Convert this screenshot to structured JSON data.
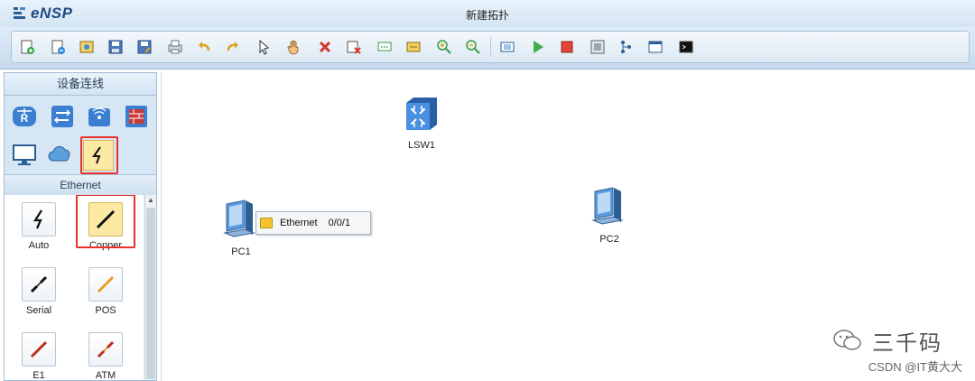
{
  "app": {
    "name": "eNSP",
    "window_title": "新建拓扑"
  },
  "toolbar": {
    "icons": [
      "new-topology-icon",
      "open-sample-icon",
      "open-icon",
      "save-icon",
      "save-as-icon",
      "print-icon",
      "undo-icon",
      "redo-icon",
      "select-icon",
      "pan-hand-icon",
      "delete-icon",
      "delete-all-links-icon",
      "text-icon",
      "rectangle-icon",
      "zoom-in-icon",
      "zoom-out-icon",
      "fit-icon",
      "start-icon",
      "stop-icon",
      "capture-icon",
      "topology-icon",
      "window-icon",
      "terminal-icon"
    ]
  },
  "left_panel": {
    "header": "设备连线",
    "device_categories": [
      "router-icon",
      "switch-icon",
      "wireless-icon",
      "firewall-icon",
      "pc-icon",
      "cloud-icon",
      "connection-icon"
    ],
    "selected_category": "connection-icon",
    "cable_section_title": "Ethernet",
    "cables": [
      {
        "label": "Auto",
        "icon": "auto-cable-icon"
      },
      {
        "label": "Copper",
        "icon": "copper-cable-icon",
        "selected": true
      },
      {
        "label": "Serial",
        "icon": "serial-cable-icon"
      },
      {
        "label": "POS",
        "icon": "pos-cable-icon"
      },
      {
        "label": "E1",
        "icon": "e1-cable-icon"
      },
      {
        "label": "ATM",
        "icon": "atm-cable-icon"
      }
    ]
  },
  "canvas": {
    "nodes": [
      {
        "label": "LSW1",
        "type": "switch"
      },
      {
        "label": "PC1",
        "type": "pc"
      },
      {
        "label": "PC2",
        "type": "pc"
      }
    ],
    "tooltip": {
      "interface": "Ethernet",
      "port": "0/0/1"
    }
  },
  "watermark": {
    "brand": "三千码",
    "credit": "CSDN @IT黄大大"
  },
  "colors": {
    "highlight_box": "#e8322a",
    "panel_bg": "#d6e6f4",
    "switch_blue": "#3a7fd0"
  }
}
